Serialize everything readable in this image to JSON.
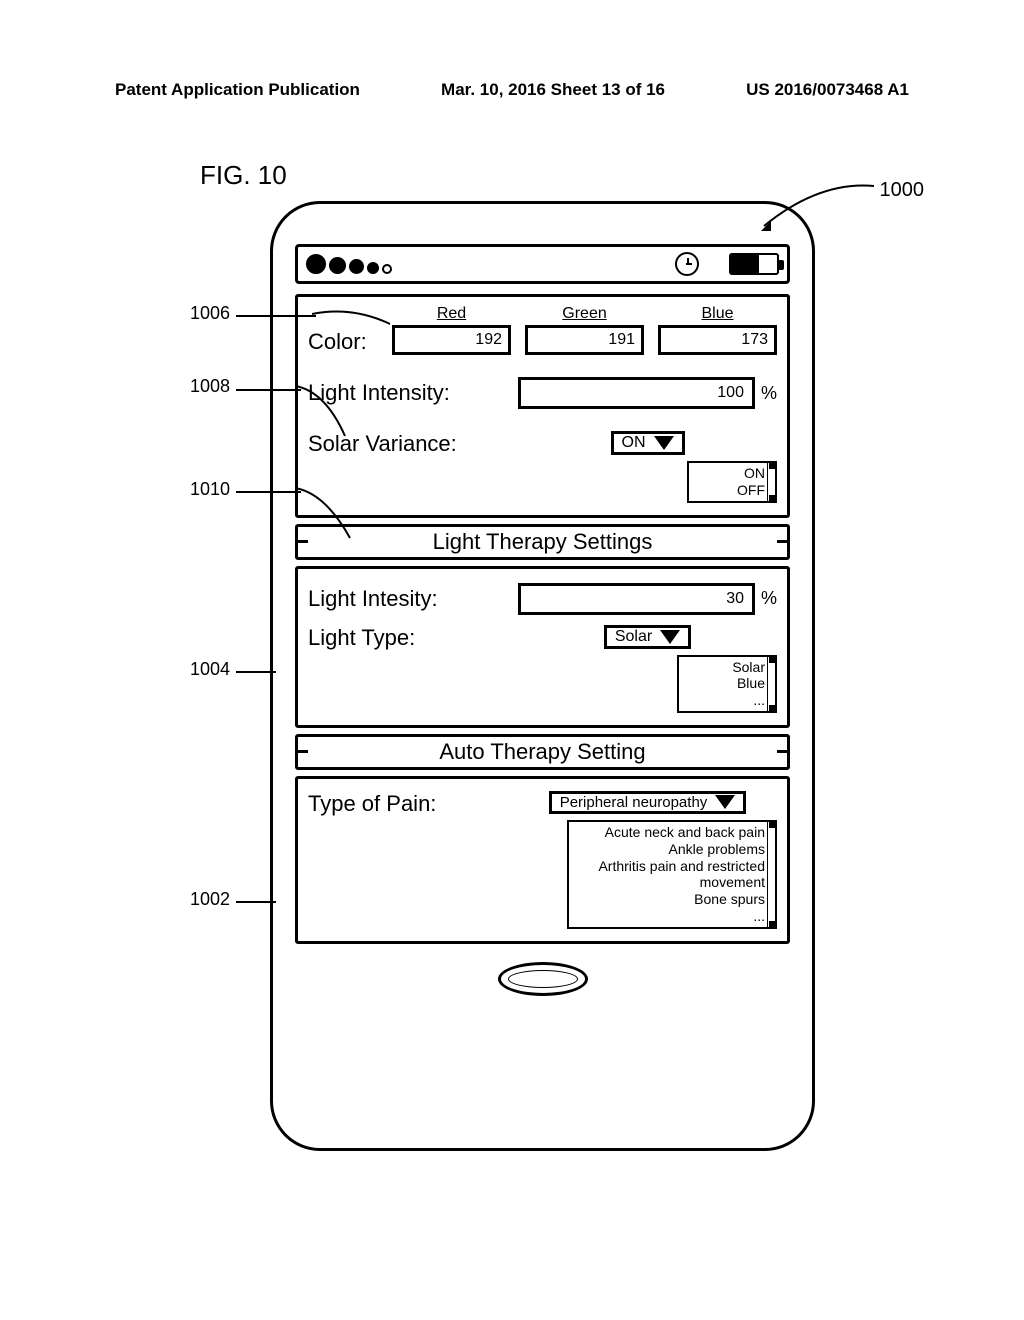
{
  "header": {
    "left": "Patent Application Publication",
    "mid": "Mar. 10, 2016  Sheet 13 of 16",
    "right": "US 2016/0073468 A1"
  },
  "figure_label": "FIG. 10",
  "refs": {
    "r1000": "1000",
    "r1006": "1006",
    "r1008": "1008",
    "r1010": "1010",
    "r1004": "1004",
    "r1002": "1002"
  },
  "sections": {
    "color": {
      "label": "Color:",
      "red_hdr": "Red",
      "red_val": "192",
      "green_hdr": "Green",
      "green_val": "191",
      "blue_hdr": "Blue",
      "blue_val": "173"
    },
    "intensity1": {
      "label": "Light Intensity:",
      "value": "100",
      "unit": "%"
    },
    "solar_variance": {
      "label": "Solar Variance:",
      "value": "ON",
      "opt1": "ON",
      "opt2": "OFF"
    },
    "therapy_title": "Light Therapy Settings",
    "intensity2": {
      "label": "Light Intesity:",
      "value": "30",
      "unit": "%"
    },
    "light_type": {
      "label": "Light Type:",
      "value": "Solar",
      "opt1": "Solar",
      "opt2": "Blue",
      "opt3": "..."
    },
    "auto_title": "Auto Therapy Setting",
    "pain": {
      "label": "Type of Pain:",
      "value": "Peripheral neuropathy",
      "opt1": "Acute neck and back pain",
      "opt2": "Ankle problems",
      "opt3": "Arthritis pain and restricted",
      "opt4": "movement",
      "opt5": "Bone spurs",
      "opt6": "..."
    }
  }
}
